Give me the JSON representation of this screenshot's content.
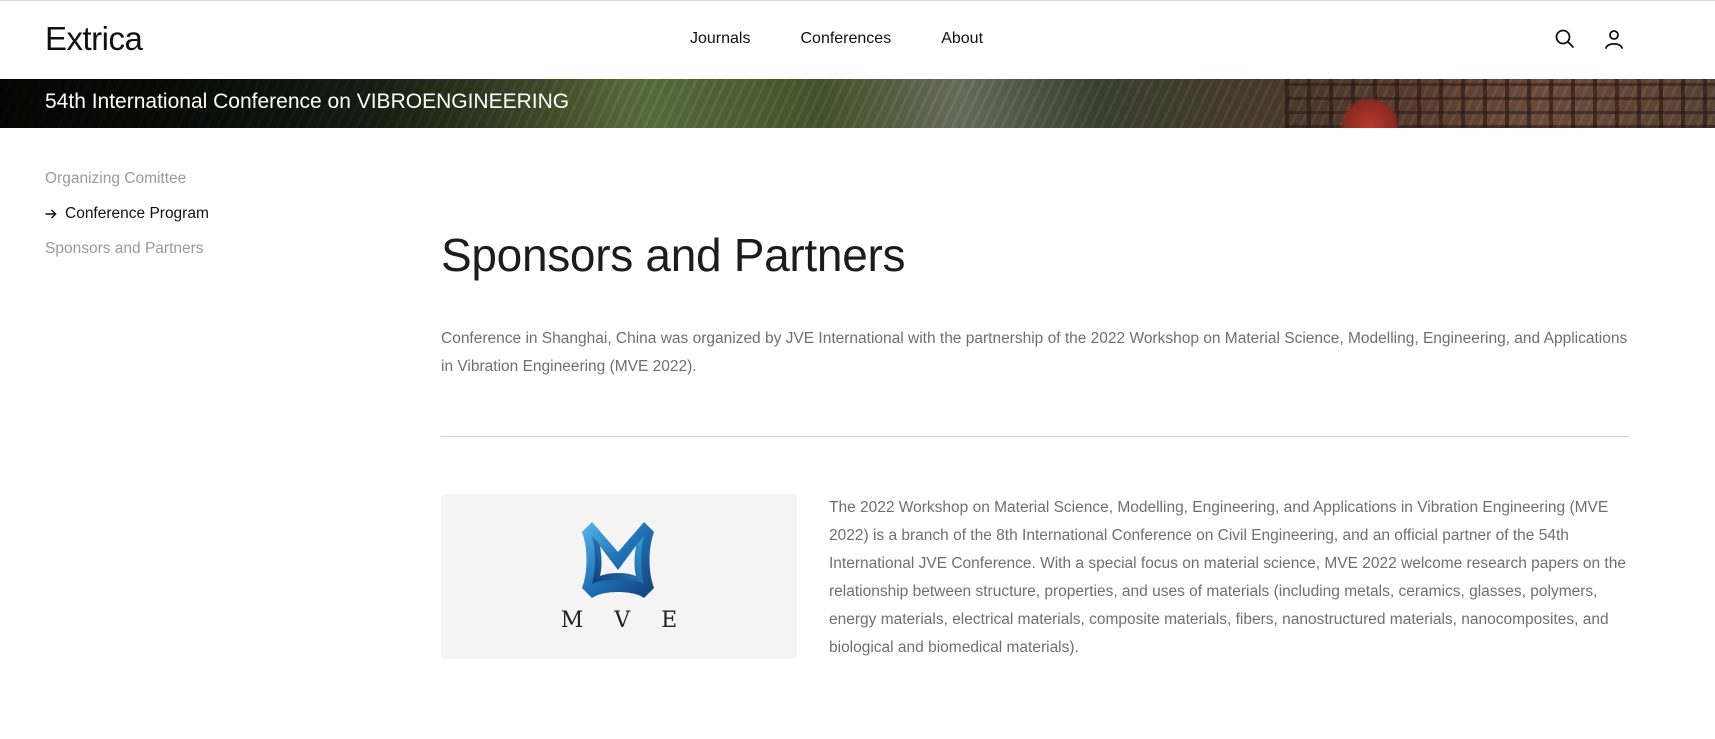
{
  "site": {
    "logo": "Extrica"
  },
  "nav": {
    "items": [
      {
        "label": "Journals"
      },
      {
        "label": "Conferences"
      },
      {
        "label": "About"
      }
    ],
    "icons": [
      "search-icon",
      "user-icon"
    ]
  },
  "banner": {
    "title": "54th International Conference on VIBROENGINEERING"
  },
  "sidebar": {
    "items": [
      {
        "label": "Organizing Comittee",
        "active": false
      },
      {
        "label": "Conference Program",
        "active": true
      },
      {
        "label": "Sponsors and Partners",
        "active": false
      }
    ]
  },
  "main": {
    "title": "Sponsors and Partners",
    "intro": "Conference in Shanghai, China was organized by JVE International with the partnership of the 2022 Workshop on Material Science, Modelling, Engineering, and Applications in Vibration Engineering (MVE 2022).",
    "partner": {
      "logo_text": "M V E",
      "logo_color": "#2a7fc4",
      "description": "The 2022 Workshop on Material Science, Modelling, Engineering, and Applications in Vibration Engineering (MVE 2022) is a branch of the 8th International Conference on Civil Engineering, and an official partner of the 54th International JVE Conference. With a special focus on material science, MVE 2022 welcome research papers on the relationship between structure, properties, and uses of materials (including metals, ceramics, glasses, polymers, energy materials, electrical materials, composite materials, fibers, nanostructured materials, nanocomposites, and biological and biomedical materials)."
    }
  },
  "colors": {
    "text_primary": "#111111",
    "text_muted": "#9a9a9a",
    "body_text": "#6f6f6f",
    "divider": "#d0d0d0"
  }
}
